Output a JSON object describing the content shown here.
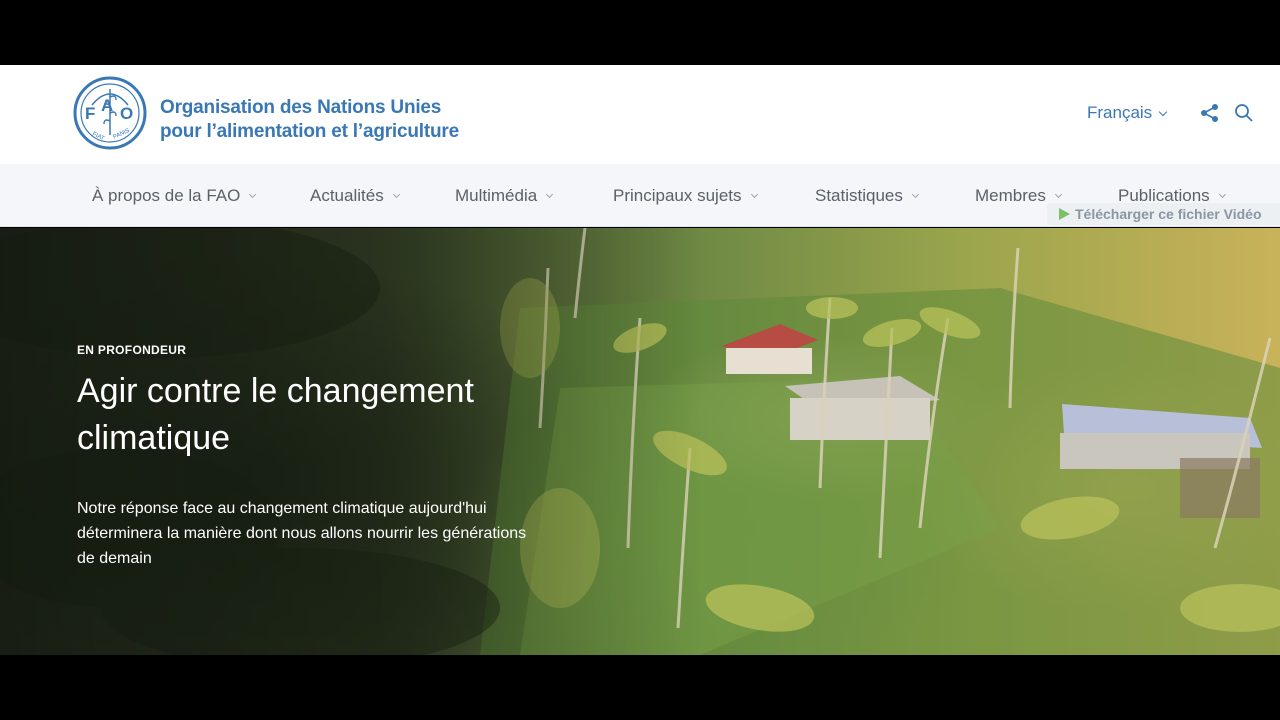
{
  "header": {
    "logo_text": "FAO",
    "logo_subtext": "FIAT PANIS",
    "org_name_line1": "Organisation des Nations Unies",
    "org_name_line2": "pour l’alimentation et l’agriculture",
    "language": "Français",
    "icons": [
      "share-icon",
      "search-icon"
    ]
  },
  "nav": {
    "items": [
      {
        "label": "À propos de la FAO"
      },
      {
        "label": "Actualités"
      },
      {
        "label": "Multimédia"
      },
      {
        "label": "Principaux sujets"
      },
      {
        "label": "Statistiques"
      },
      {
        "label": "Membres"
      },
      {
        "label": "Publications"
      }
    ]
  },
  "hero": {
    "eyebrow": "EN PROFONDEUR",
    "title": "Agir contre le changement climatique",
    "description": "Notre réponse face au changement climatique aujourd'hui déterminera la manière dont nous allons nourrir les générations de demain"
  },
  "overlay": {
    "download_label": "Télécharger ce fichier Vidéo"
  },
  "colors": {
    "brand_blue": "#3a78b5",
    "nav_bg": "#f4f6f9",
    "nav_text": "#5a6169"
  }
}
